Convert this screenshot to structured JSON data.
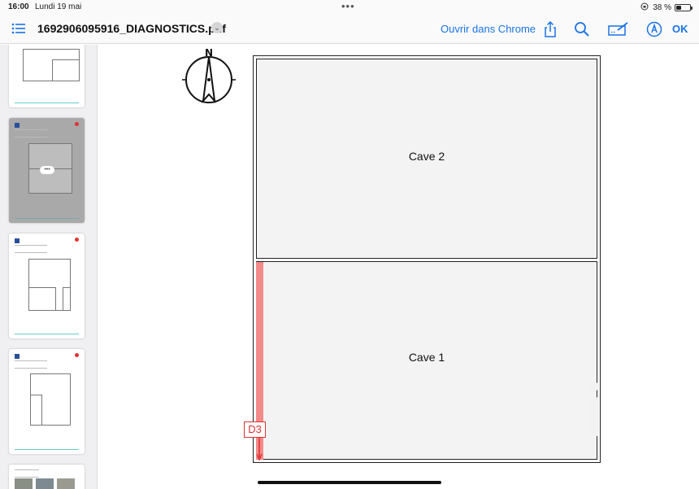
{
  "status_bar": {
    "time": "16:00",
    "date": "Lundi 19 mai",
    "multitask": "•••",
    "battery_percent_text": "38 %",
    "battery_level": 0.38,
    "icons": [
      "orientation-lock-icon",
      "battery-icon"
    ]
  },
  "toolbar": {
    "file_name": "1692906095916_DIAGNOSTICS.pdf",
    "open_in_label": "Ouvrir dans Chrome",
    "done_label": "OK",
    "icons": [
      "list-icon",
      "chevron-down-icon",
      "share-icon",
      "search-icon",
      "markup-icon",
      "pen-icon"
    ],
    "accent_color": "#1a73e8"
  },
  "sidebar": {
    "thumbnails": [
      {
        "page": 1,
        "selected": false
      },
      {
        "page": 2,
        "selected": true,
        "more_label": "•••"
      },
      {
        "page": 3,
        "selected": false
      },
      {
        "page": 4,
        "selected": false
      },
      {
        "page": 5,
        "selected": false
      }
    ]
  },
  "document": {
    "compass_label": "N",
    "rooms": [
      {
        "name": "Cave 2"
      },
      {
        "name": "Cave 1"
      }
    ],
    "marker_label": "D3",
    "highlight_color": "#f28a8a",
    "marker_color": "#dd3333"
  }
}
